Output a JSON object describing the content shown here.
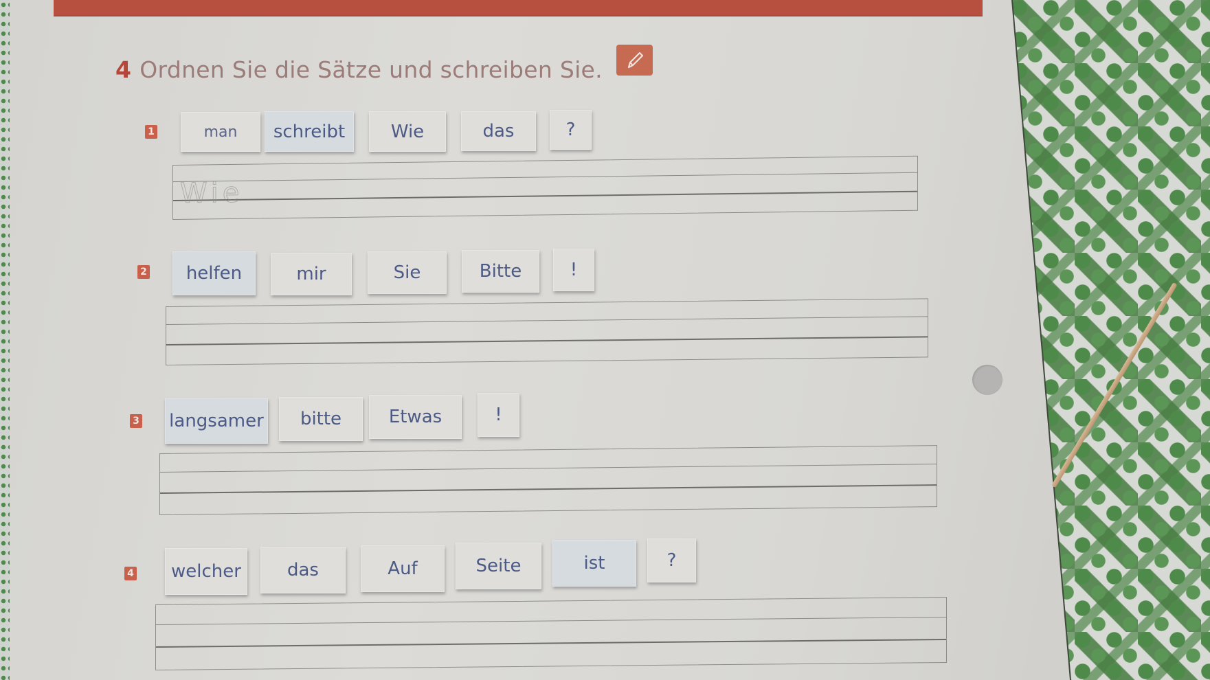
{
  "exercise": {
    "number": "4",
    "instruction": "Ordnen Sie die Sätze und schreiben Sie.",
    "icon": "pencil-icon",
    "accent_color": "#b85040"
  },
  "tasks": [
    {
      "badge": "1",
      "tiles": [
        "man",
        "schreibt",
        "Wie",
        "das",
        "?"
      ],
      "answer_hint": "Wie",
      "answer_value": ""
    },
    {
      "badge": "2",
      "tiles": [
        "helfen",
        "mir",
        "Sie",
        "Bitte",
        "!"
      ],
      "answer_value": ""
    },
    {
      "badge": "3",
      "tiles": [
        "langsamer",
        "bitte",
        "Etwas",
        "!"
      ],
      "answer_value": ""
    },
    {
      "badge": "4",
      "tiles": [
        "welcher",
        "das",
        "Auf",
        "Seite",
        "ist",
        "?"
      ],
      "answer_value": ""
    }
  ]
}
